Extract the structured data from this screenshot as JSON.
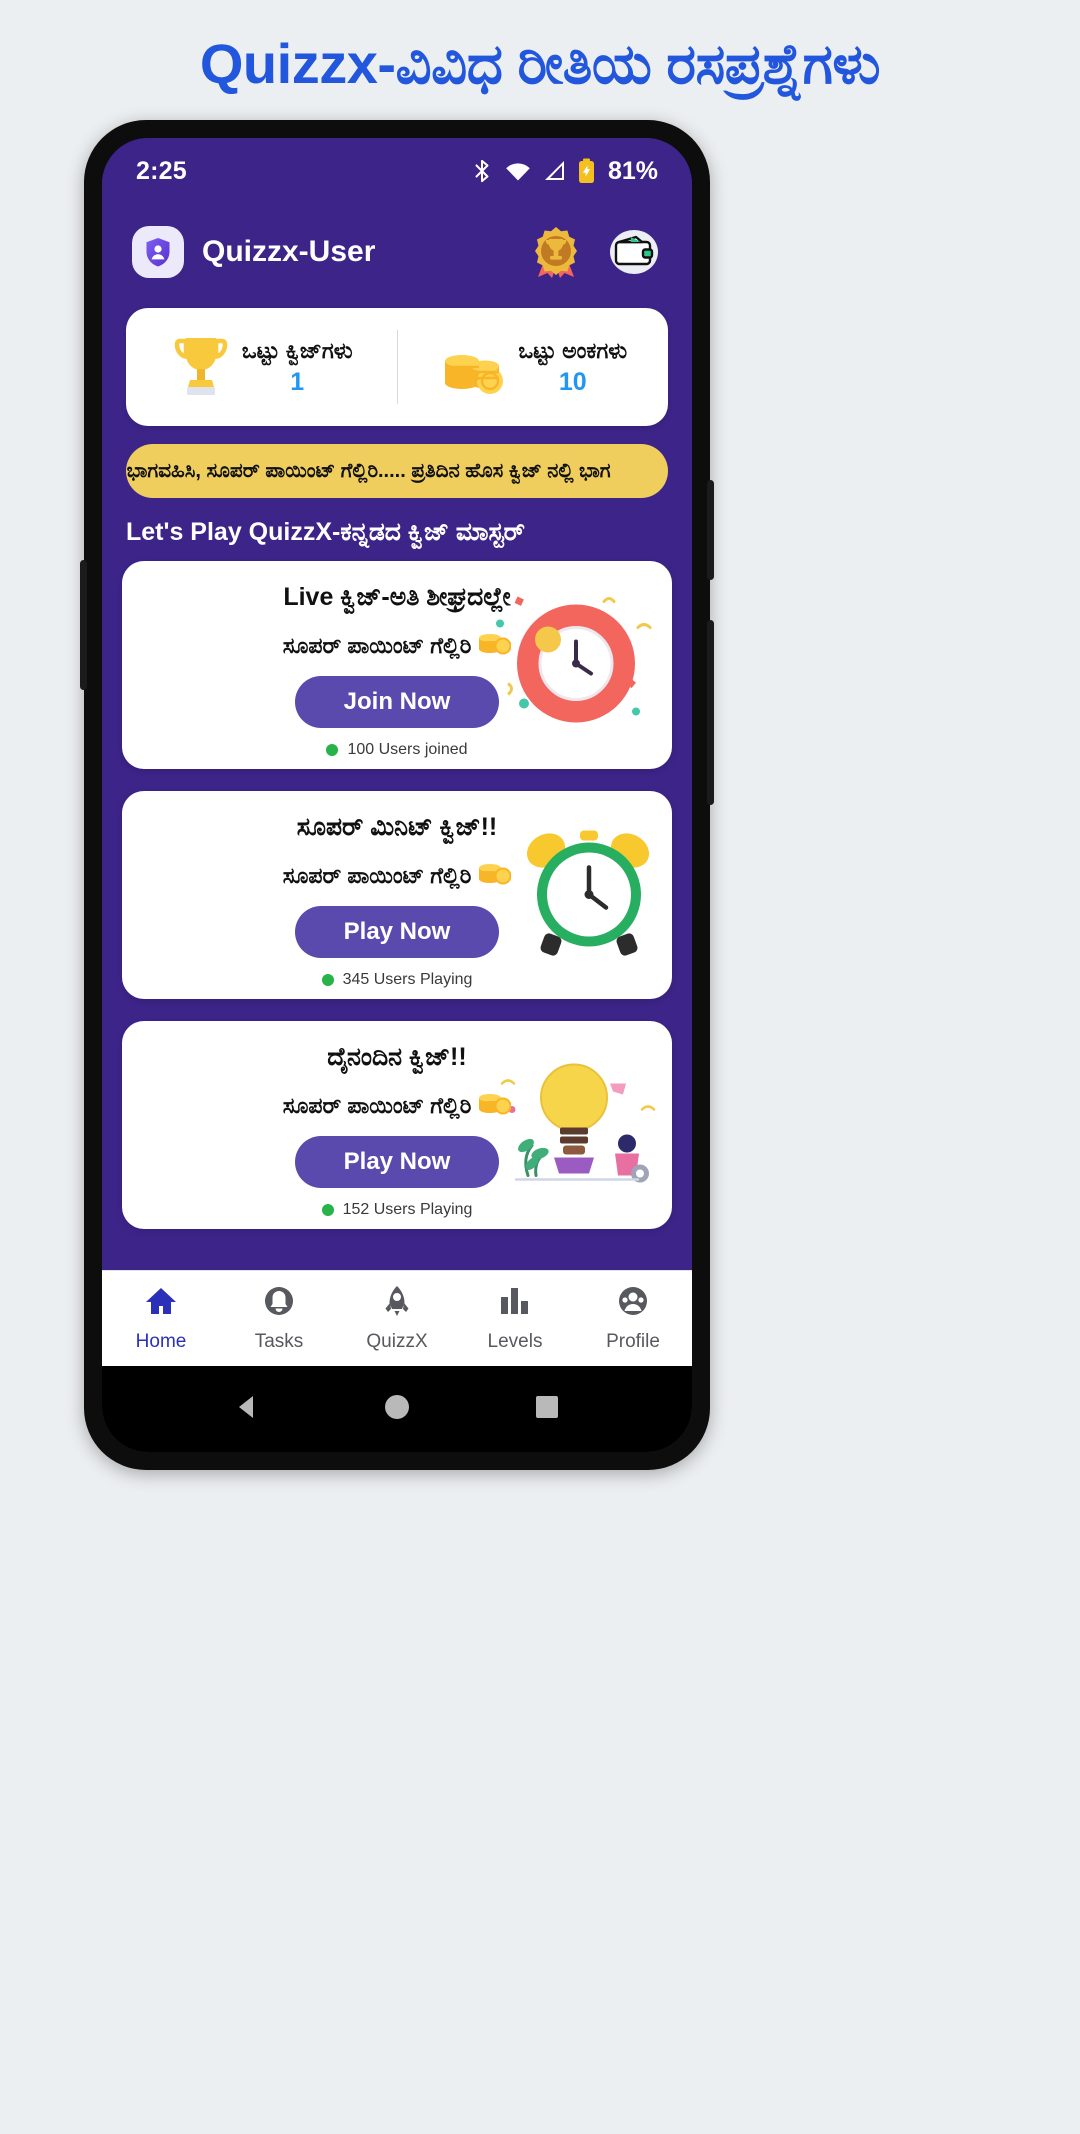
{
  "page": {
    "title": "Quizzx-ವಿವಿಧ ರೀತಿಯ ರಸಪ್ರಶ್ನೆಗಳು",
    "title_color": "#2156dd",
    "background": "#eceff1"
  },
  "status_bar": {
    "time": "2:25",
    "battery_percent": "81%",
    "icons": [
      "bluetooth-icon",
      "wifi-icon",
      "cellular-signal-icon",
      "battery-icon"
    ]
  },
  "app_bar": {
    "avatar_icon": "user-shield-avatar-icon",
    "title": "Quizzx-User",
    "actions": [
      {
        "icon": "award-medal-icon"
      },
      {
        "icon": "wallet-icon"
      }
    ],
    "background": "#3d2489"
  },
  "stats": {
    "items": [
      {
        "icon": "trophy-icon",
        "label": "ಒಟ್ಟು ಕ್ವಿಜ್‌ಗಳು",
        "value": "1"
      },
      {
        "icon": "coins-icon",
        "label": "ಒಟ್ಟು ಅಂಕಗಳು",
        "value": "10"
      }
    ],
    "value_color": "#2196f3"
  },
  "marquee": {
    "text": "ಲ್ಲಿ ಭಾಗವಹಿಸಿ, ಸೂಪರ್ ಪಾಯಿಂಟ್ ಗೆಲ್ಲಿರಿ..... ಪ್ರತಿದಿನ ಹೊಸ ಕ್ವಿಜ್ ನಲ್ಲಿ ಭಾಗ",
    "background": "#f0ce5e"
  },
  "section": {
    "heading": "Let's Play QuizzX-ಕನ್ನಡದ ಕ್ವಿಜ್ ಮಾಸ್ಟರ್"
  },
  "cards": [
    {
      "title": "Live ಕ್ವಿಜ್-ಅತಿ ಶೀಘ್ರದಲ್ಲೇ",
      "subtitle": "ಸೂಪರ್ ಪಾಯಿಂಟ್ ಗೆಲ್ಲಿರಿ",
      "cta": "Join Now",
      "status": "100 Users joined",
      "art": "clock-confetti-illustration"
    },
    {
      "title": "ಸೂಪರ್ ಮಿನಿಟ್ ಕ್ವಿಜ್!!",
      "subtitle": "ಸೂಪರ್ ಪಾಯಿಂಟ್ ಗೆಲ್ಲಿರಿ",
      "cta": "Play Now",
      "status": "345 Users Playing",
      "art": "alarm-clock-illustration"
    },
    {
      "title": "ದೈನಂದಿನ ಕ್ವಿಜ್!!",
      "subtitle": "ಸೂಪರ್ ಪಾಯಿಂಟ್ ಗೆಲ್ಲಿರಿ",
      "cta": "Play Now",
      "status": "152 Users Playing",
      "art": "lightbulb-idea-illustration"
    }
  ],
  "bottom_nav": {
    "active_index": 0,
    "active_color": "#2a31b8",
    "items": [
      {
        "label": "Home",
        "icon": "home-icon"
      },
      {
        "label": "Tasks",
        "icon": "bell-icon"
      },
      {
        "label": "QuizzX",
        "icon": "rocket-icon"
      },
      {
        "label": "Levels",
        "icon": "bar-chart-icon"
      },
      {
        "label": "Profile",
        "icon": "person-circle-icon"
      }
    ]
  },
  "system_nav": {
    "items": [
      "back-triangle-icon",
      "home-circle-icon",
      "recents-square-icon"
    ]
  }
}
